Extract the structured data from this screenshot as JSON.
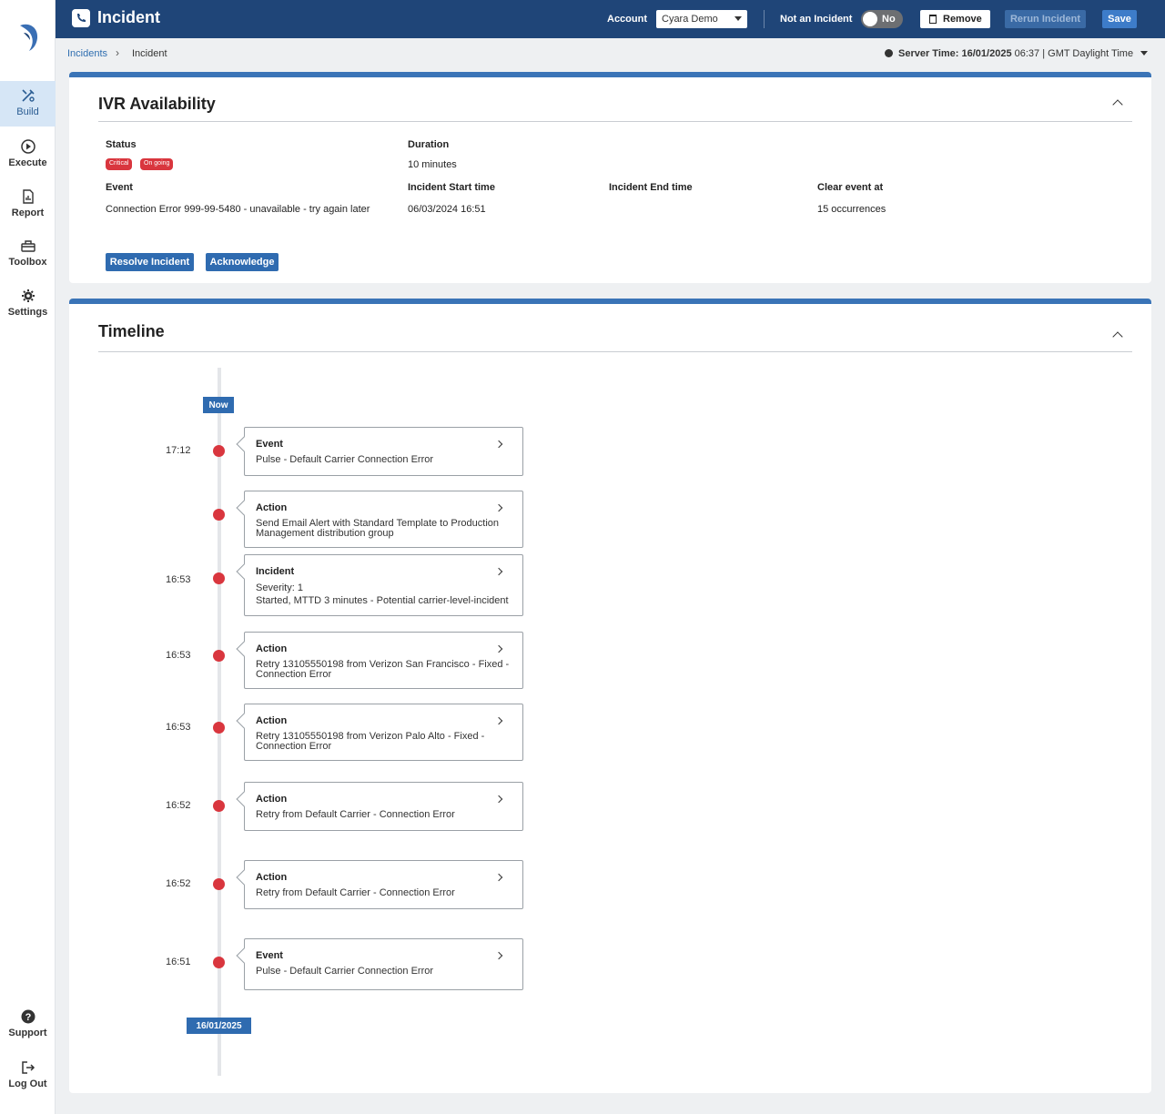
{
  "sidebar": {
    "items": [
      {
        "label": "Build",
        "icon": "build-icon"
      },
      {
        "label": "Execute",
        "icon": "play-icon"
      },
      {
        "label": "Report",
        "icon": "report-icon"
      },
      {
        "label": "Toolbox",
        "icon": "toolbox-icon"
      },
      {
        "label": "Settings",
        "icon": "gear-icon"
      }
    ],
    "bottom": [
      {
        "label": "Support",
        "icon": "help-icon"
      },
      {
        "label": "Log Out",
        "icon": "logout-icon"
      }
    ]
  },
  "header": {
    "title": "Incident",
    "account_label": "Account",
    "account_value": "Cyara Demo",
    "not_incident_label": "Not an Incident",
    "toggle_value": "No",
    "remove_label": "Remove",
    "rerun_label": "Rerun Incident",
    "save_label": "Save"
  },
  "breadcrumb": {
    "parent": "Incidents",
    "current": "Incident",
    "server_time_label": "Server Time:",
    "server_time_date": "16/01/2025",
    "server_time_rest": "06:37 | GMT Daylight Time"
  },
  "incident": {
    "title": "IVR Availability",
    "status_label": "Status",
    "badges": [
      "Critical",
      "On going"
    ],
    "duration_label": "Duration",
    "duration_value": "10 minutes",
    "event_label": "Event",
    "event_value": "Connection Error 999-99-5480 - unavailable - try again later",
    "start_label": "Incident Start time",
    "start_value": "06/03/2024 16:51",
    "end_label": "Incident End time",
    "clear_label": "Clear event at",
    "clear_value": "15 occurrences",
    "resolve_label": "Resolve Incident",
    "ack_label": "Acknowledge"
  },
  "timeline": {
    "title": "Timeline",
    "now_label": "Now",
    "date_label": "16/01/2025",
    "entries": [
      {
        "time": "17:12",
        "type": "Event",
        "lines": [
          "Pulse - Default Carrier Connection Error"
        ]
      },
      {
        "time": "",
        "type": "Action",
        "lines": [
          "Send Email Alert with Standard Template to Production Management distribution group"
        ]
      },
      {
        "time": "16:53",
        "type": "Incident",
        "lines": [
          "Severity: 1",
          "Started, MTTD 3 minutes - Potential carrier-level-incident"
        ]
      },
      {
        "time": "16:53",
        "type": "Action",
        "lines": [
          "Retry 13105550198 from Verizon San Francisco - Fixed - Connection Error"
        ]
      },
      {
        "time": "16:53",
        "type": "Action",
        "lines": [
          "Retry 13105550198 from Verizon Palo Alto - Fixed - Connection Error"
        ]
      },
      {
        "time": "16:52",
        "type": "Action",
        "lines": [
          "Retry from Default Carrier - Connection Error"
        ]
      },
      {
        "time": "16:52",
        "type": "Action",
        "lines": [
          "Retry from Default Carrier - Connection Error"
        ]
      },
      {
        "time": "16:51",
        "type": "Event",
        "lines": [
          "Pulse - Default Carrier Connection Error"
        ]
      }
    ]
  }
}
